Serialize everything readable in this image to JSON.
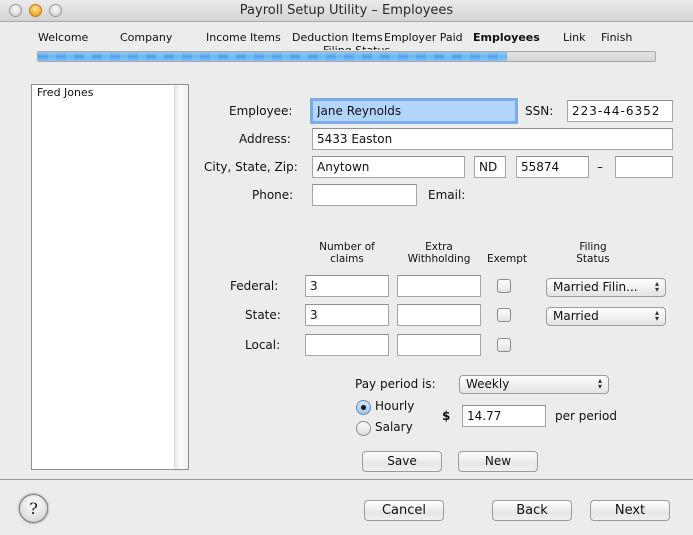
{
  "window": {
    "title": "Payroll Setup Utility – Employees"
  },
  "steps": {
    "items": [
      {
        "label": "Welcome"
      },
      {
        "label": "Company"
      },
      {
        "label": "Income Items"
      },
      {
        "label": "Deduction Items"
      },
      {
        "label": "Employer Paid"
      },
      {
        "label": "Employees",
        "active": true
      },
      {
        "label": "Link"
      },
      {
        "label": "Finish"
      }
    ],
    "ghost_label": "Filing Status",
    "progress_fraction": 0.76
  },
  "employee_list": {
    "items": [
      "Fred Jones"
    ]
  },
  "form": {
    "employee_label": "Employee:",
    "employee_value": "Jane Reynolds",
    "ssn_label": "SSN:",
    "ssn_value": "223-44-6352",
    "address_label": "Address:",
    "address_value": "5433 Easton",
    "city_state_zip_label": "City, State, Zip:",
    "city_value": "Anytown",
    "state_value": "ND",
    "zip_value": "55874",
    "zip_dash": "–",
    "zip_ext_value": "",
    "phone_label": "Phone:",
    "phone_value": "",
    "email_label": "Email:"
  },
  "withholding": {
    "headers": {
      "claims": "Number of\nclaims",
      "extra": "Extra\nWithholding",
      "exempt": "Exempt",
      "filing": "Filing\nStatus"
    },
    "rows": [
      {
        "label": "Federal:",
        "claims": "3",
        "extra": "",
        "exempt": false,
        "filing_status": "Married Filin..."
      },
      {
        "label": "State:",
        "claims": "3",
        "extra": "",
        "exempt": false,
        "filing_status": "Married"
      },
      {
        "label": "Local:",
        "claims": "",
        "extra": "",
        "exempt": false
      }
    ]
  },
  "pay": {
    "period_label": "Pay period is:",
    "period_value": "Weekly",
    "hourly_label": "Hourly",
    "salary_label": "Salary",
    "selected": "Hourly",
    "currency": "$",
    "amount": "14.77",
    "per_label": "per period"
  },
  "buttons": {
    "save": "Save",
    "new": "New",
    "cancel": "Cancel",
    "back": "Back",
    "next": "Next",
    "help": "?"
  }
}
